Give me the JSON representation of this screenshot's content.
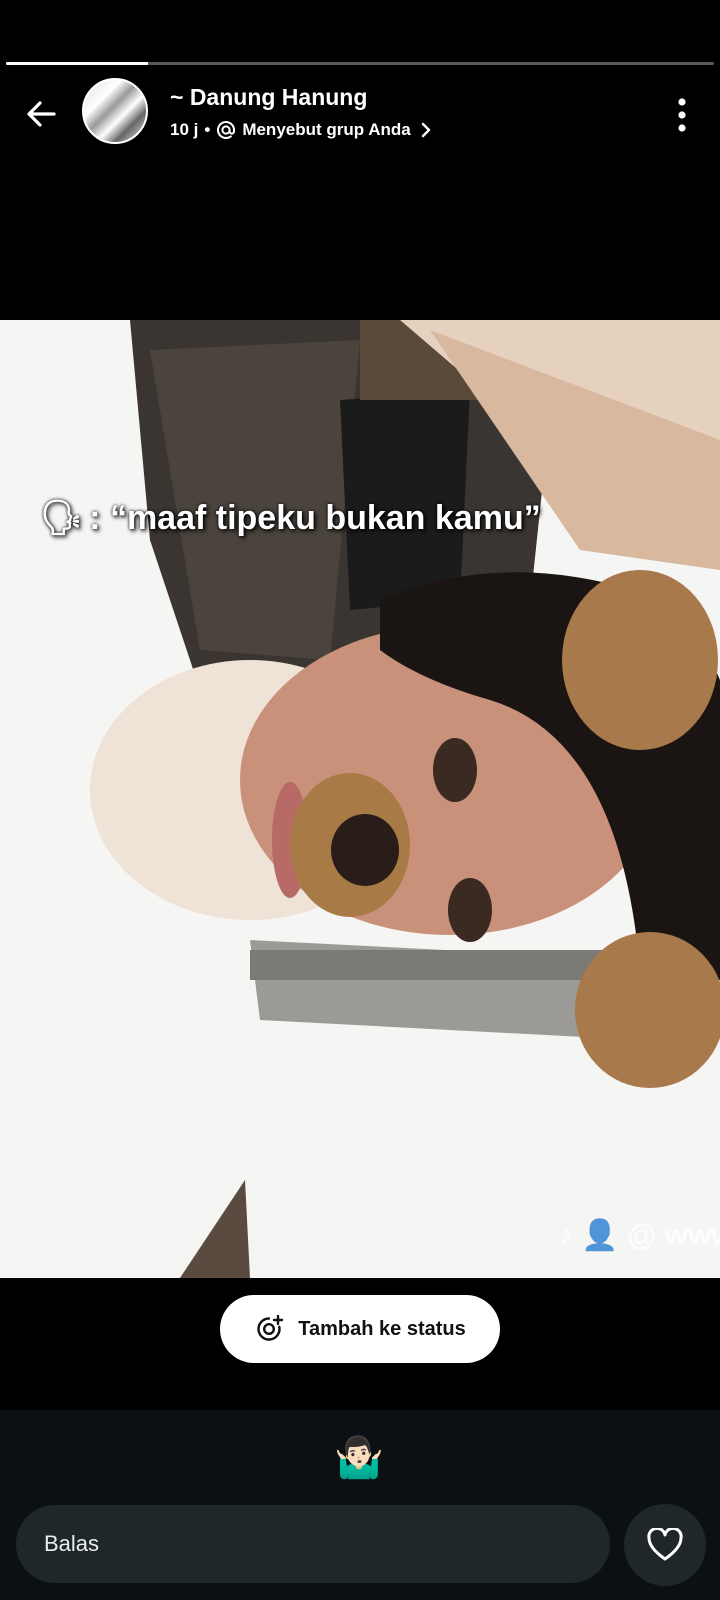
{
  "story": {
    "progress_fraction": 0.2,
    "author": "~ Danung Hanung",
    "time": "10 j",
    "separator": "•",
    "mention_text": "Menyebut grup Anda"
  },
  "media": {
    "caption_emoji": "🗣",
    "caption_text": ": “maaf tipeku bukan kamu”",
    "watermark": "♪ 👤 @ www"
  },
  "actions": {
    "add_status_label": "Tambah ke status"
  },
  "footer": {
    "reaction_emoji": "🤷🏻‍♂️",
    "reply_placeholder": "Balas"
  },
  "icons": {
    "back": "arrow-left-icon",
    "menu": "more-vertical-icon",
    "mention": "at-sign-icon",
    "chevron": "chevron-right-icon",
    "add_status": "status-add-icon",
    "like": "heart-icon"
  }
}
